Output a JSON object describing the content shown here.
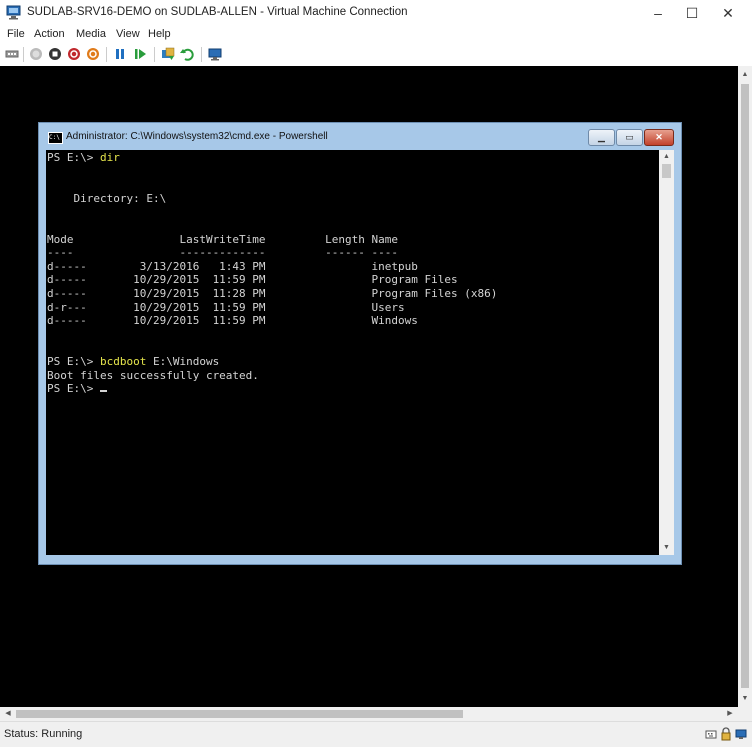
{
  "window": {
    "title": "SUDLAB-SRV16-DEMO on SUDLAB-ALLEN - Virtual Machine Connection",
    "minimize": "–",
    "maximize": "☐",
    "close": "✕"
  },
  "menu": [
    {
      "label": "File"
    },
    {
      "label": "Action"
    },
    {
      "label": "Media"
    },
    {
      "label": "View"
    },
    {
      "label": "Help"
    }
  ],
  "toolbar": {
    "icons": [
      "ctrl-alt-del-icon",
      "start-icon",
      "turn-off-icon",
      "shut-down-icon",
      "save-icon",
      "pause-icon",
      "reset-icon",
      "checkpoint-icon",
      "revert-icon",
      "enhanced-session-icon"
    ]
  },
  "cmd": {
    "title": "Administrator: C:\\Windows\\system32\\cmd.exe - Powershell",
    "icon_text": "C:\\",
    "lines": [
      {
        "prompt": "PS E:\\> ",
        "command": "dir",
        "text": ""
      },
      {
        "prompt": "",
        "command": "",
        "text": ""
      },
      {
        "prompt": "",
        "command": "",
        "text": ""
      },
      {
        "prompt": "",
        "command": "",
        "text": "    Directory: E:\\"
      },
      {
        "prompt": "",
        "command": "",
        "text": ""
      },
      {
        "prompt": "",
        "command": "",
        "text": ""
      },
      {
        "prompt": "",
        "command": "",
        "text": "Mode                LastWriteTime         Length Name"
      },
      {
        "prompt": "",
        "command": "",
        "text": "----                -------------         ------ ----"
      },
      {
        "prompt": "",
        "command": "",
        "text": "d-----        3/13/2016   1:43 PM                inetpub"
      },
      {
        "prompt": "",
        "command": "",
        "text": "d-----       10/29/2015  11:59 PM                Program Files"
      },
      {
        "prompt": "",
        "command": "",
        "text": "d-----       10/29/2015  11:28 PM                Program Files (x86)"
      },
      {
        "prompt": "",
        "command": "",
        "text": "d-r---       10/29/2015  11:59 PM                Users"
      },
      {
        "prompt": "",
        "command": "",
        "text": "d-----       10/29/2015  11:59 PM                Windows"
      },
      {
        "prompt": "",
        "command": "",
        "text": ""
      },
      {
        "prompt": "",
        "command": "",
        "text": ""
      },
      {
        "prompt": "PS E:\\> ",
        "command": "bcdboot",
        "text": " E:\\Windows"
      },
      {
        "prompt": "",
        "command": "",
        "text": "Boot files successfully created."
      },
      {
        "prompt": "PS E:\\> ",
        "command": "",
        "text": ""
      }
    ]
  },
  "status": {
    "text": "Status: Running"
  },
  "colors": {
    "console_bg": "#000000",
    "console_text": "#d4d4d4",
    "command_highlight": "#e5e54c",
    "cmd_frame": "#a7c8e8"
  }
}
